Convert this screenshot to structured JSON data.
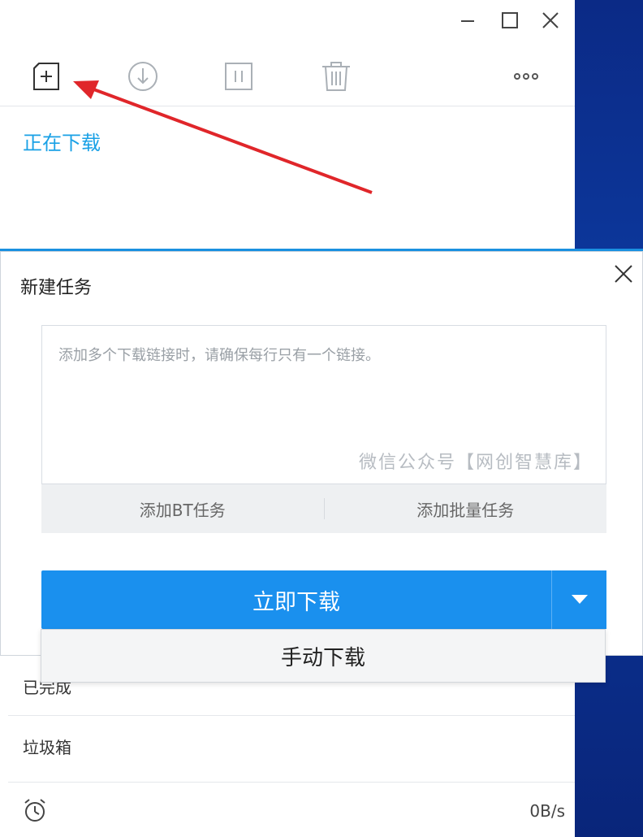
{
  "toolbar": {
    "new_task_icon": "add-file-icon",
    "download_icon": "download-icon",
    "pause_icon": "pause-icon",
    "delete_icon": "trash-icon",
    "more_icon": "more-icon"
  },
  "nav": {
    "downloading": "正在下载",
    "completed": "已完成",
    "trash": "垃圾箱"
  },
  "dialog": {
    "title": "新建任务",
    "url_placeholder": "添加多个下载链接时，请确保每行只有一个链接。",
    "watermark": "微信公众号【网创智慧库】",
    "add_bt": "添加BT任务",
    "add_batch": "添加批量任务",
    "download_now": "立即下载",
    "manual_download": "手动下载"
  },
  "status": {
    "speed": "0B/s"
  },
  "colors": {
    "accent": "#1a90ee",
    "tab_active": "#1aa1e6",
    "annotation_arrow": "#e0262a"
  }
}
